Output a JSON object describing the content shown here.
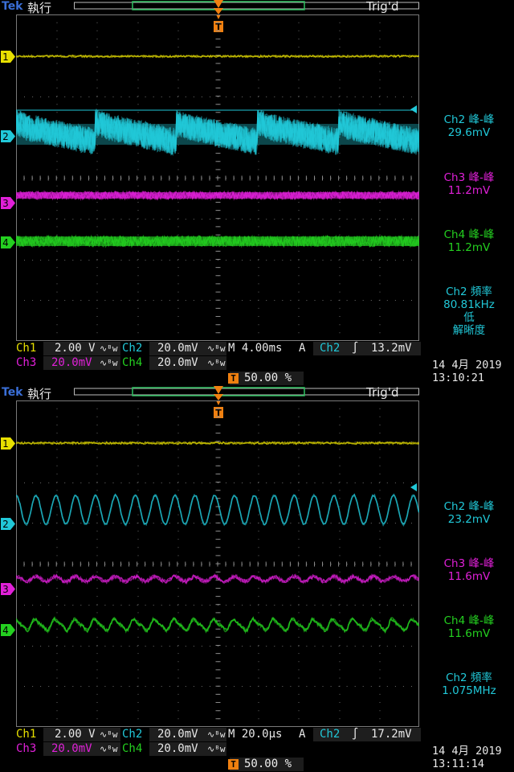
{
  "screens": [
    {
      "brand": "Tek",
      "mode": "執行",
      "trig_status": "Trig'd",
      "trigger_marker": "T",
      "channel_markers": [
        "1",
        "2",
        "3",
        "4"
      ],
      "measurements": {
        "ch2_label": "Ch2 峰-峰",
        "ch2_value": "29.6mV",
        "ch3_label": "Ch3 峰-峰",
        "ch3_value": "11.2mV",
        "ch4_label": "Ch4 峰-峰",
        "ch4_value": "11.2mV",
        "freq_label": "Ch2 頻率",
        "freq_value": "80.81kHz",
        "freq_note_1": "低",
        "freq_note_2": "解晰度"
      },
      "settings": {
        "ch1_name": "Ch1",
        "ch1_scale": "2.00 V",
        "ch2_name": "Ch2",
        "ch2_scale": "20.0mV",
        "ch3_name": "Ch3",
        "ch3_scale": "20.0mV",
        "ch4_name": "Ch4",
        "ch4_scale": "20.0mV",
        "bw_symbol": "∿ᴮw",
        "timebase": "M 4.00ms",
        "trig_mode": "A",
        "trig_source": "Ch2",
        "trig_slope": "∫",
        "trig_level": "13.2mV",
        "trig_position": "50.00 %"
      },
      "date": "14 4月  2019",
      "time": "13:10:21",
      "colors": {
        "ch1": "#e8e000",
        "ch2": "#21c8d8",
        "ch3": "#e020d8",
        "ch4": "#24d020"
      }
    },
    {
      "brand": "Tek",
      "mode": "執行",
      "trig_status": "Trig'd",
      "trigger_marker": "T",
      "channel_markers": [
        "1",
        "2",
        "3",
        "4"
      ],
      "measurements": {
        "ch2_label": "Ch2 峰-峰",
        "ch2_value": "23.2mV",
        "ch3_label": "Ch3 峰-峰",
        "ch3_value": "11.6mV",
        "ch4_label": "Ch4 峰-峰",
        "ch4_value": "11.6mV",
        "freq_label": "Ch2 頻率",
        "freq_value": "1.075MHz"
      },
      "settings": {
        "ch1_name": "Ch1",
        "ch1_scale": "2.00 V",
        "ch2_name": "Ch2",
        "ch2_scale": "20.0mV",
        "ch3_name": "Ch3",
        "ch3_scale": "20.0mV",
        "ch4_name": "Ch4",
        "ch4_scale": "20.0mV",
        "bw_symbol": "∿ᴮw",
        "timebase": "M 20.0µs",
        "trig_mode": "A",
        "trig_source": "Ch2",
        "trig_slope": "∫",
        "trig_level": "17.2mV",
        "trig_position": "50.00 %"
      },
      "date": "14 4月  2019",
      "time": "13:11:14",
      "colors": {
        "ch1": "#e8e000",
        "ch2": "#21c8d8",
        "ch3": "#e020d8",
        "ch4": "#24d020"
      }
    }
  ]
}
